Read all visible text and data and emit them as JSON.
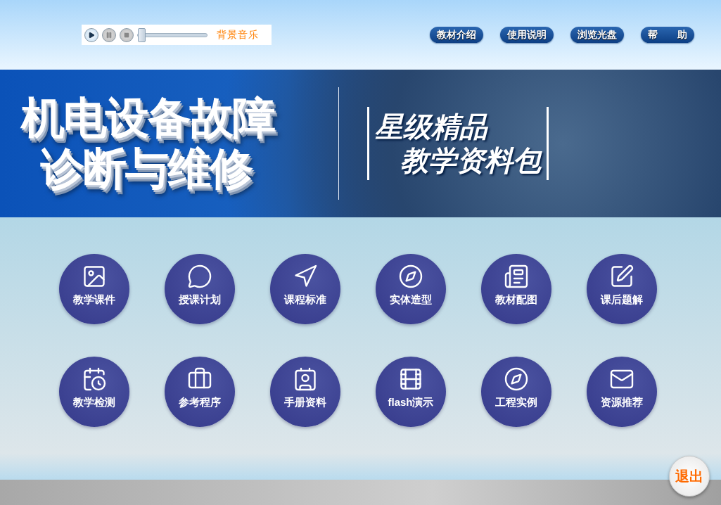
{
  "player": {
    "label": "背景音乐",
    "level": 0
  },
  "nav_buttons": [
    "教材介绍",
    "使用说明",
    "浏览光盘",
    "帮　　助"
  ],
  "banner": {
    "title_lines": [
      "机电设备故障",
      "诊断与维修"
    ],
    "subtitle_lines": [
      "星级精品",
      "教学资料包"
    ]
  },
  "tiles": [
    {
      "label": "教学课件"
    },
    {
      "label": "授课计划"
    },
    {
      "label": "课程标准"
    },
    {
      "label": "实体造型"
    },
    {
      "label": "教材配图"
    },
    {
      "label": "课后题解"
    },
    {
      "label": "教学检测"
    },
    {
      "label": "参考程序"
    },
    {
      "label": "手册资料"
    },
    {
      "label": "flash演示"
    },
    {
      "label": "工程实例"
    },
    {
      "label": "资源推荐"
    }
  ],
  "exit_button": "退出"
}
